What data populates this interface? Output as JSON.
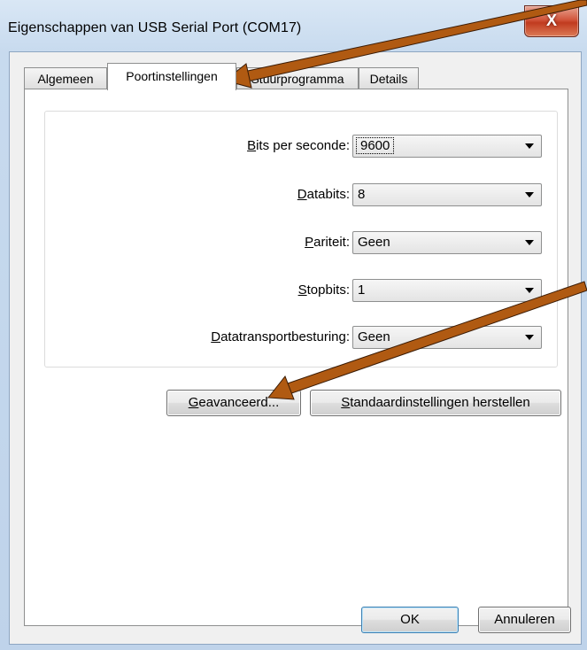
{
  "window": {
    "title": "Eigenschappen van USB Serial Port (COM17)",
    "close_label": "X"
  },
  "tabs": [
    {
      "label": "Algemeen",
      "active": false
    },
    {
      "label": "Poortinstellingen",
      "active": true
    },
    {
      "label": "Stuurprogramma",
      "active": false
    },
    {
      "label": "Details",
      "active": false
    }
  ],
  "settings": {
    "bits_per_second": {
      "label_accel": "B",
      "label_rest": "its per seconde:",
      "value": "9600"
    },
    "databits": {
      "label_accel": "D",
      "label_rest": "atabits:",
      "value": "8"
    },
    "parity": {
      "label_accel": "P",
      "label_rest": "ariteit:",
      "value": "Geen"
    },
    "stopbits": {
      "label_accel": "S",
      "label_rest": "topbits:",
      "value": "1"
    },
    "flow_control": {
      "label_accel": "D",
      "label_rest": "atatransportbesturing:",
      "value": "Geen"
    }
  },
  "buttons": {
    "advanced_accel": "G",
    "advanced_rest": "eavanceerd...",
    "restore_accel": "S",
    "restore_rest": "tandaardinstellingen herstellen",
    "ok": "OK",
    "cancel": "Annuleren"
  },
  "colors": {
    "annotation_arrow": "#b05a12",
    "close_button": "#c9452a"
  }
}
